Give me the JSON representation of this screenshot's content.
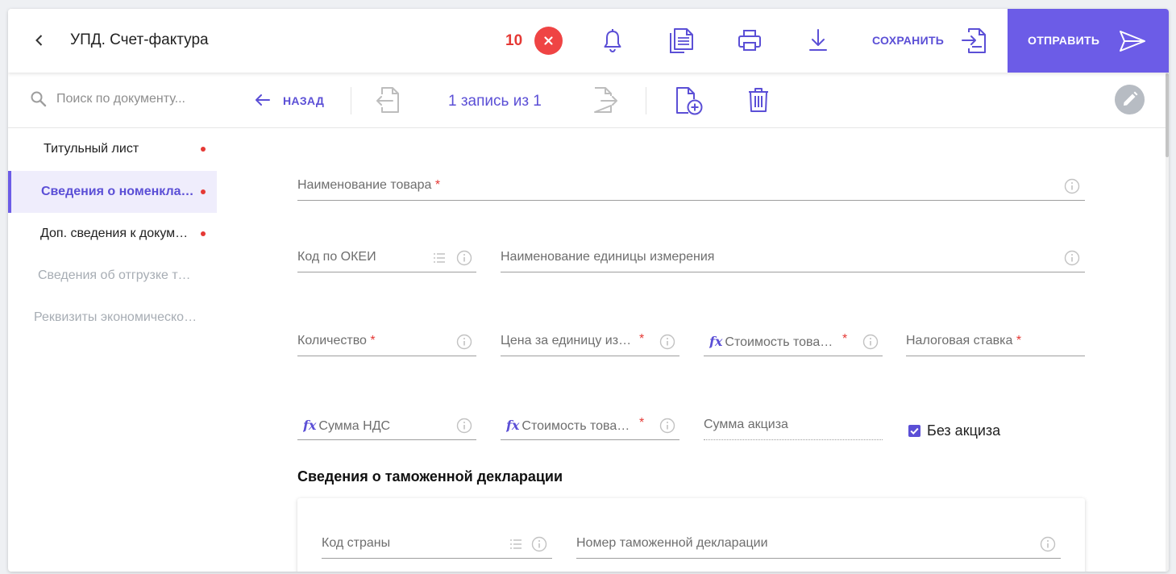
{
  "header": {
    "title": "УПД. Счет-фактура",
    "error_count": "10",
    "save_label": "СОХРАНИТЬ",
    "send_label": "ОТПРАВИТЬ",
    "icons": [
      "bell-icon",
      "copy-documents-icon",
      "print-icon",
      "download-icon",
      "save-import-icon",
      "send-icon"
    ]
  },
  "toolbar": {
    "search_placeholder": "Поиск по документу...",
    "back_label": "НАЗАД",
    "record_counter": "1 запись из 1"
  },
  "sidebar": {
    "items": [
      {
        "label": "Титульный лист",
        "error": true,
        "active": false,
        "disabled": false
      },
      {
        "label": "Сведения о номенклатуре",
        "error": true,
        "active": true,
        "disabled": false
      },
      {
        "label": "Доп. сведения к документу",
        "error": true,
        "active": false,
        "disabled": false
      },
      {
        "label": "Сведения об отгрузке товаров",
        "error": false,
        "active": false,
        "disabled": true
      },
      {
        "label": "Реквизиты экономического субъекта",
        "error": false,
        "active": false,
        "disabled": true
      }
    ]
  },
  "form": {
    "product_name": "Наименование товара",
    "okei_code": "Код по ОКЕИ",
    "unit_name": "Наименование единицы измерения",
    "quantity": "Количество",
    "unit_price": "Цена за единицу измерения",
    "cost_without_tax": "Стоимость товаров без налога",
    "tax_rate": "Налоговая ставка",
    "vat_amount": "Сумма НДС",
    "cost_with_tax": "Стоимость товаров с налогом",
    "excise_amount": "Сумма акциза",
    "no_excise_label": "Без акциза",
    "no_excise_checked": true,
    "fx_symbol": "fx",
    "required_mark": "*"
  },
  "customs": {
    "section_title": "Сведения о таможенной декларации",
    "country_code": "Код страны",
    "declaration_number": "Номер таможенной декларации"
  },
  "colors": {
    "accent": "#6c5ce7",
    "accent_text": "#5b4fd6",
    "error": "#e53935",
    "active_bg": "#efedfc"
  }
}
